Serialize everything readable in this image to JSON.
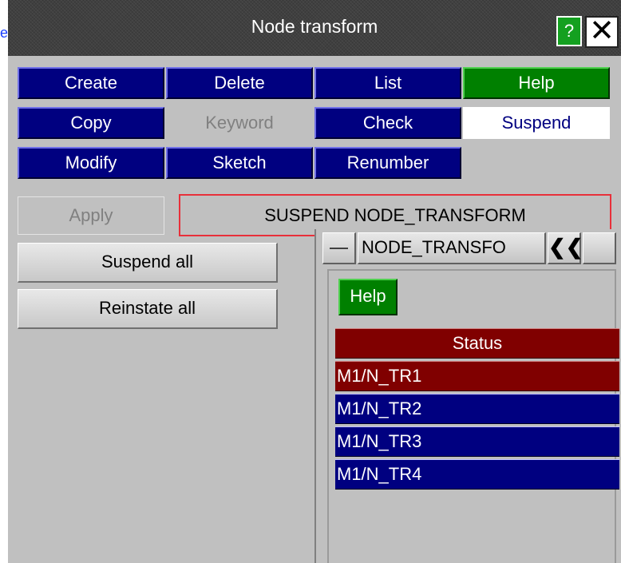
{
  "edge_link": "e",
  "window": {
    "title": "Node transform",
    "help_btn": "?",
    "close_btn": "✕"
  },
  "buttons": {
    "create": "Create",
    "delete": "Delete",
    "list": "List",
    "help": "Help",
    "copy": "Copy",
    "keyword": "Keyword",
    "check": "Check",
    "suspend": "Suspend",
    "modify": "Modify",
    "sketch": "Sketch",
    "renumber": "Renumber"
  },
  "apply": "Apply",
  "mode_label": "SUSPEND NODE_TRANSFORM",
  "suspend_all": "Suspend all",
  "reinstate_all": "Reinstate all",
  "sub_panel": {
    "title": "NODE_TRANSFO",
    "chevron": "❮❮",
    "help": "Help",
    "status_header": "Status",
    "rows": [
      {
        "label": "M1/N_TR1",
        "state": "suspended"
      },
      {
        "label": "M1/N_TR2",
        "state": "active"
      },
      {
        "label": "M1/N_TR3",
        "state": "active"
      },
      {
        "label": "M1/N_TR4",
        "state": "active"
      }
    ]
  },
  "colors": {
    "button_blue": "#000080",
    "button_green": "#008000",
    "status_red": "#800000",
    "accent_border": "#e8303a"
  }
}
